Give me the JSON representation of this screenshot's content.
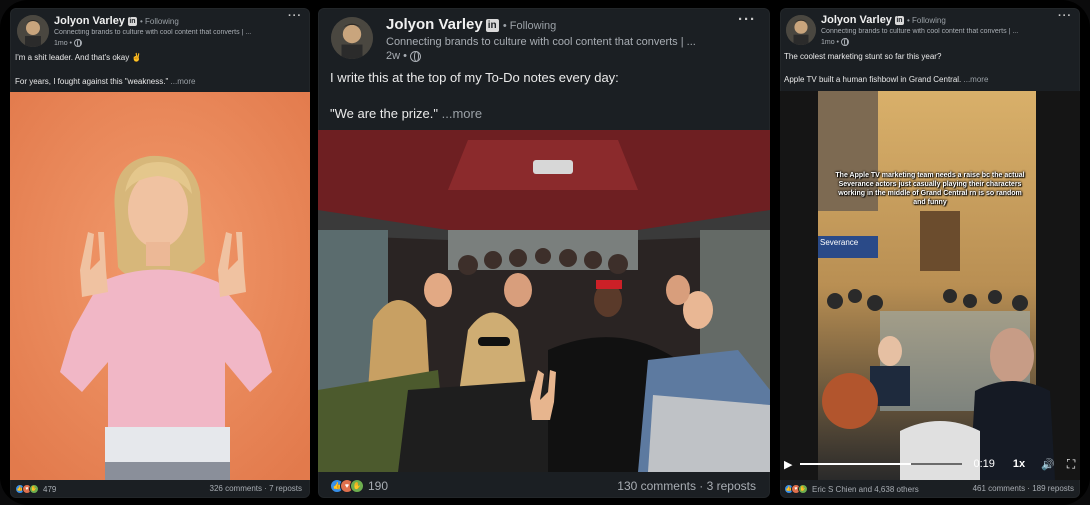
{
  "posts": [
    {
      "author": "Jolyon Varley",
      "badge": "in",
      "following": "• Following",
      "subtitle": "Connecting brands to culture with cool content that converts | ...",
      "time": "1mo •",
      "line1": "I'm a shit leader. And that's okay ✌",
      "line2": "For years, I fought against this \"weakness.\"",
      "more": "...more",
      "reaction_count": "479",
      "stats": "326 comments · 7 reposts"
    },
    {
      "author": "Jolyon Varley",
      "badge": "in",
      "following": "• Following",
      "subtitle": "Connecting brands to culture with cool content that converts | ...",
      "time": "2w •",
      "line1": "I write this at the top of my To-Do notes every day:",
      "line2": "\"We are the prize.\"",
      "more": "...more",
      "reaction_count": "190",
      "stats": "130 comments · 3 reposts"
    },
    {
      "author": "Jolyon Varley",
      "badge": "in",
      "following": "• Following",
      "subtitle": "Connecting brands to culture with cool content that converts | ...",
      "time": "1mo •",
      "line1": "The coolest marketing stunt so far this year?",
      "line2": "Apple TV built a human fishbowl in Grand Central.",
      "more": "...more",
      "reaction_count": "Eric S Chien and 4,638 others",
      "stats": "461 comments · 189 reposts",
      "video_caption": "The Apple TV marketing team needs a raise bc the actual Severance actors just casually playing their characters working in the middle of Grand Central rn is so random and funny",
      "video_sign": "Severance",
      "video_time": "0:19",
      "video_speed": "1x",
      "video_progress": 0.68
    }
  ],
  "colors": {
    "card_bg": "#1b1f23",
    "photo1_bg": "#ec8a5a",
    "like": "#378fe9",
    "love": "#df704d",
    "clap": "#6dae4f"
  }
}
